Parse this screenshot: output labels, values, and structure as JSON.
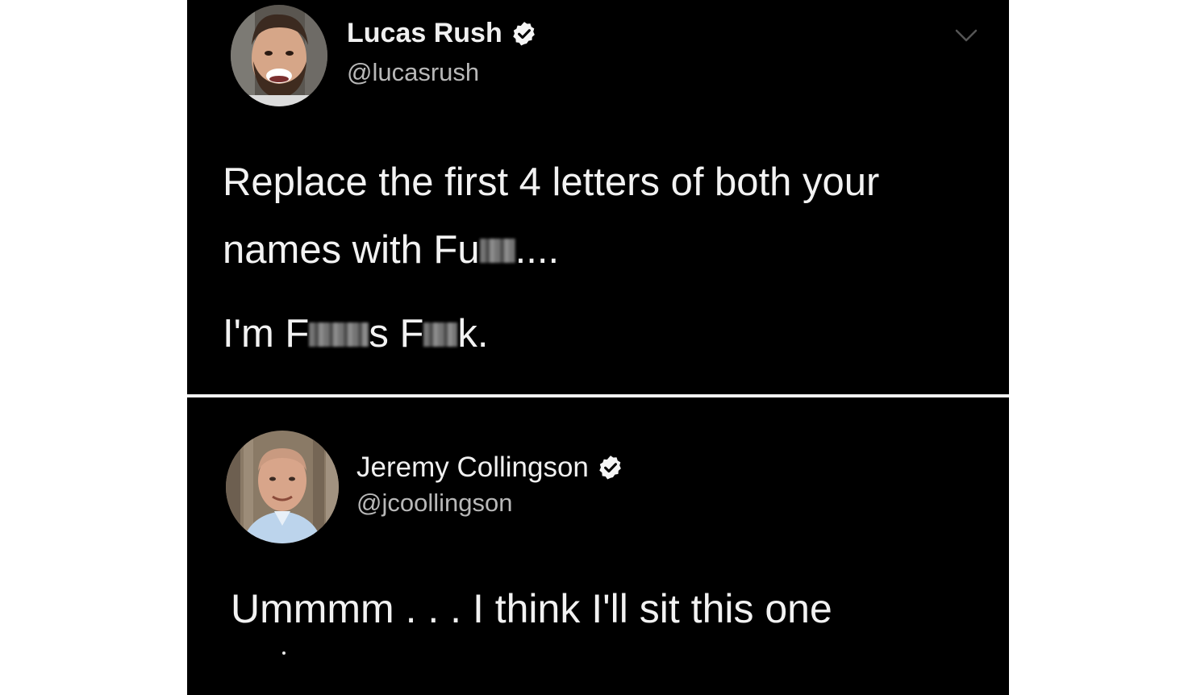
{
  "tweet": {
    "author_name": "Lucas Rush",
    "author_handle": "@lucasrush",
    "verified": true,
    "line1": "Replace the first 4 letters of both your",
    "line2_prefix": "names with Fu",
    "line2_suffix": "....",
    "line3_prefix": "I'm F",
    "line3_mid": "s F",
    "line3_suffix": "k."
  },
  "reply": {
    "author_name": "Jeremy Collingson",
    "author_handle": "@jcoollingson",
    "verified": true,
    "text": "Ummmm . . . I think I'll sit this one"
  },
  "colors": {
    "background": "#000000",
    "text_primary": "#f2f2f2",
    "text_secondary": "#b8b8b8",
    "verified_badge": "#ffffff"
  },
  "icons": {
    "verified": "verified-badge-icon",
    "menu": "chevron-down-icon"
  }
}
